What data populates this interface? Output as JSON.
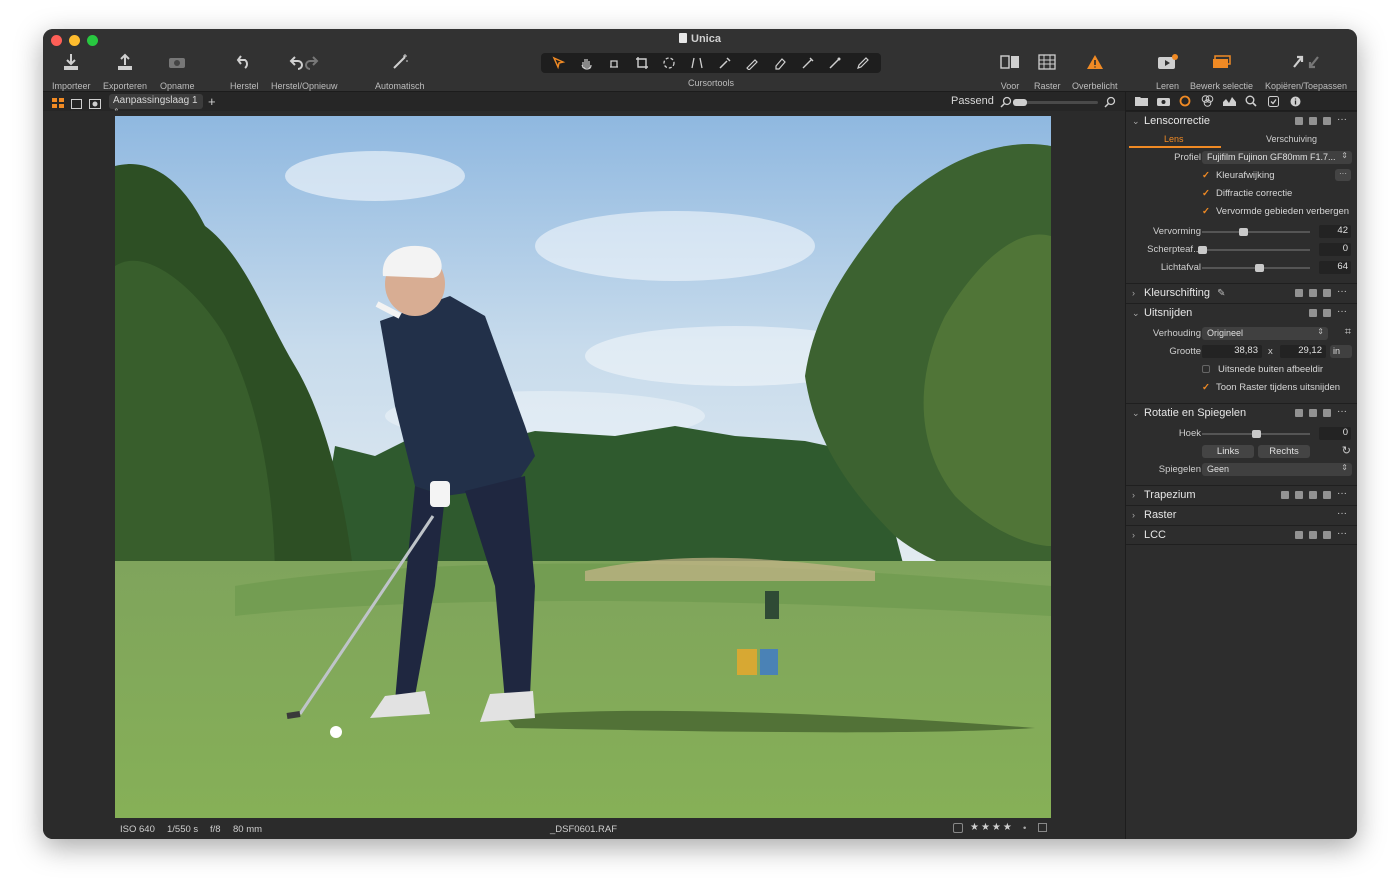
{
  "window": {
    "title": "Unica"
  },
  "toolbar": {
    "import_label": "Importeer",
    "export_label": "Exporteren",
    "capture_label": "Opname",
    "reset_label": "Herstel",
    "undo_redo_label": "Herstel/Opnieuw",
    "auto_label": "Automatisch",
    "cursor_tools_label": "Cursortools",
    "before_label": "Voor",
    "grid_label": "Raster",
    "exposure_warning_label": "Overbelicht",
    "learn_label": "Leren",
    "edit_selection_label": "Bewerk selectie",
    "copy_apply_label": "Kopiëren/Toepassen"
  },
  "subbar": {
    "layer": "Aanpassingslaag 1",
    "fit": "Passend"
  },
  "infobar": {
    "iso": "ISO 640",
    "shutter": "1/550 s",
    "aperture": "f/8",
    "focal": "80 mm",
    "filename": "_DSF0601.RAF",
    "rating": "★★★★"
  },
  "panel": {
    "lens": {
      "title": "Lenscorrectie",
      "tab_lens": "Lens",
      "tab_shift": "Verschuiving",
      "profile_label": "Profiel",
      "profile_value": "Fujifilm Fujinon GF80mm F1.7...",
      "chk_color": "Kleurafwijking",
      "chk_diffraction": "Diffractie correctie",
      "chk_hide_distorted": "Vervormde gebieden verbergen",
      "distortion_label": "Vervorming",
      "distortion_value": "42",
      "distortion": 0.38,
      "sharpness_label": "Scherpteaf...",
      "sharpness_value": "0",
      "sharpness": 0.0,
      "falloff_label": "Lichtafval",
      "falloff_value": "64",
      "falloff": 0.53
    },
    "color_fringe": {
      "title": "Kleurschifting"
    },
    "crop": {
      "title": "Uitsnijden",
      "ratio_label": "Verhouding",
      "ratio_value": "Origineel",
      "size_label": "Grootte",
      "width": "38,83",
      "times": "x",
      "height": "29,12",
      "unit": "in",
      "chk_outside": "Uitsnede buiten afbeeldir",
      "chk_grid": "Toon Raster tijdens uitsnijden"
    },
    "rotation": {
      "title": "Rotatie en Spiegelen",
      "angle_label": "Hoek",
      "angle_value": "0",
      "angle": 0.5,
      "left": "Links",
      "right": "Rechts",
      "mirror_label": "Spiegelen",
      "mirror_value": "Geen"
    },
    "keystone": {
      "title": "Trapezium"
    },
    "grid": {
      "title": "Raster"
    },
    "lcc": {
      "title": "LCC"
    }
  },
  "colors": {
    "accent": "#f08a24",
    "panel": "#2d2d2d",
    "toolbar": "#323232"
  }
}
